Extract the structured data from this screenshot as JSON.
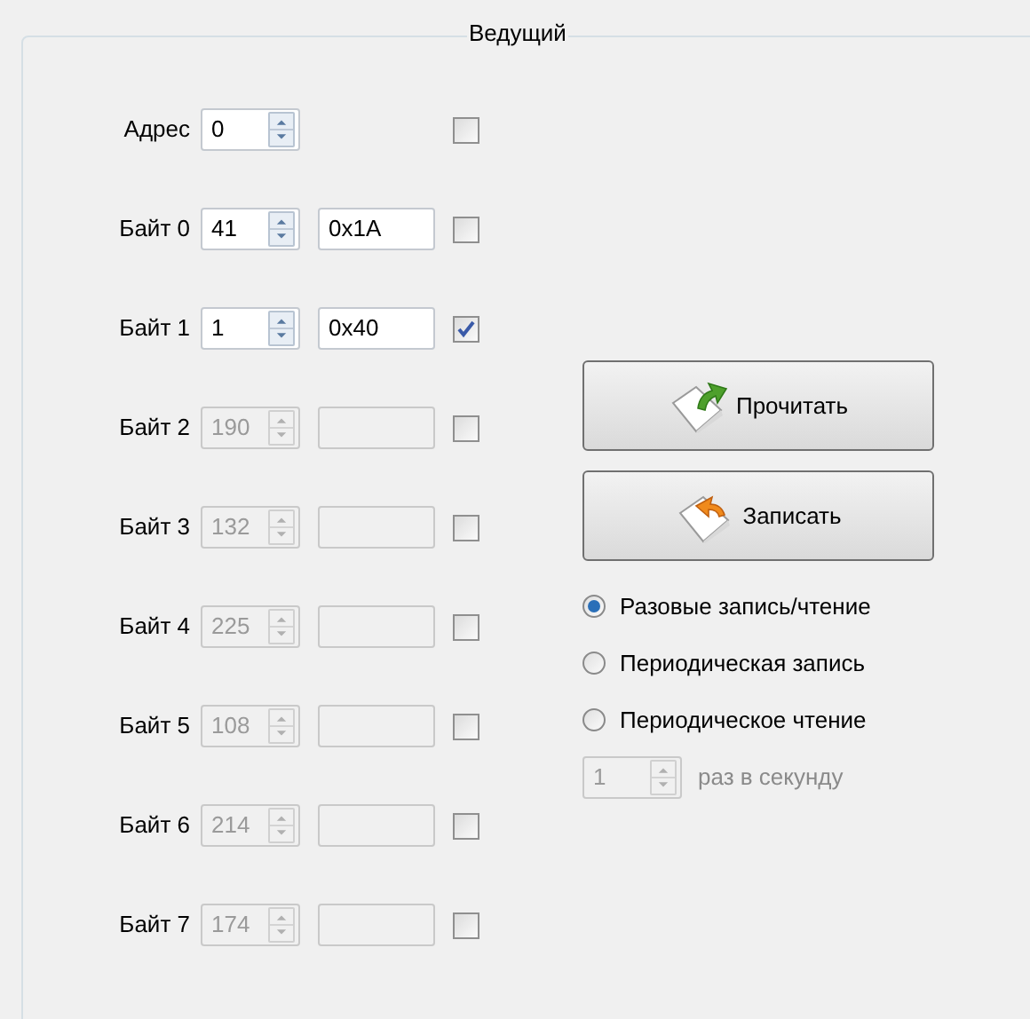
{
  "group": {
    "title": "Ведущий"
  },
  "rows": [
    {
      "kind": "address",
      "label": "Адрес",
      "value": "0",
      "disabled": false,
      "checked": false
    },
    {
      "kind": "byte",
      "label": "Байт 0",
      "value": "41",
      "hex": "0x1A",
      "disabled": false,
      "checked": false
    },
    {
      "kind": "byte",
      "label": "Байт 1",
      "value": "1",
      "hex": "0x40",
      "disabled": false,
      "checked": true
    },
    {
      "kind": "byte",
      "label": "Байт 2",
      "value": "190",
      "disabled": true,
      "checked": false
    },
    {
      "kind": "byte",
      "label": "Байт 3",
      "value": "132",
      "disabled": true,
      "checked": false
    },
    {
      "kind": "byte",
      "label": "Байт 4",
      "value": "225",
      "disabled": true,
      "checked": false
    },
    {
      "kind": "byte",
      "label": "Байт 5",
      "value": "108",
      "disabled": true,
      "checked": false
    },
    {
      "kind": "byte",
      "label": "Байт 6",
      "value": "214",
      "disabled": true,
      "checked": false
    },
    {
      "kind": "byte",
      "label": "Байт 7",
      "value": "174",
      "disabled": true,
      "checked": false
    }
  ],
  "buttons": [
    {
      "kind": "read",
      "label": "Прочитать"
    },
    {
      "kind": "write",
      "label": "Записать"
    }
  ],
  "modes": [
    {
      "label": "Разовые запись/чтение",
      "selected": true
    },
    {
      "label": "Периодическая запись",
      "selected": false
    },
    {
      "label": "Периодическое чтение",
      "selected": false
    }
  ],
  "rate": {
    "value": "1",
    "unit": "раз в секунду",
    "disabled": true
  }
}
